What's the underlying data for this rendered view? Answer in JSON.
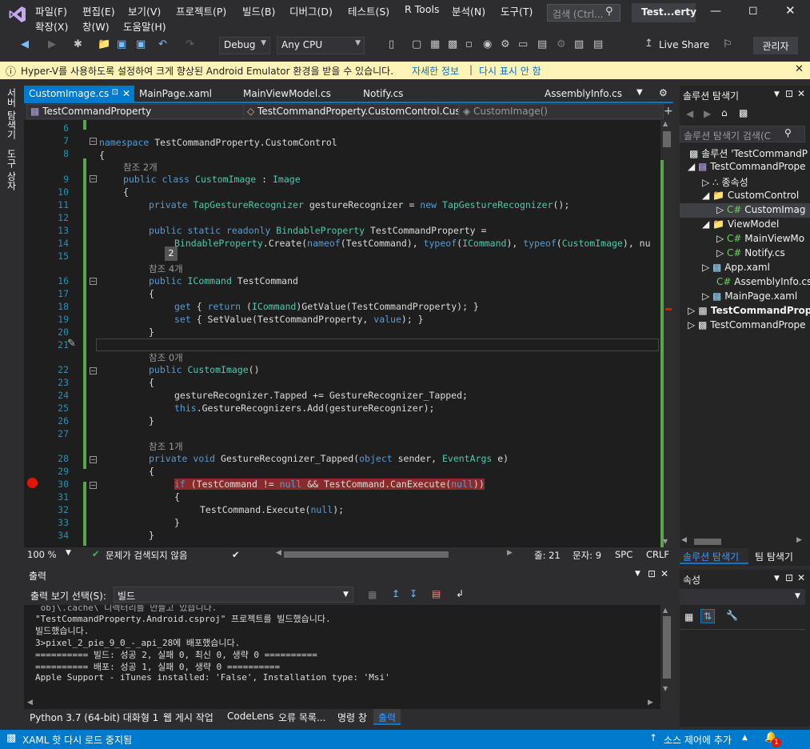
{
  "menu": {
    "row1": [
      "파일(F)",
      "편집(E)",
      "보기(V)",
      "프로젝트(P)",
      "빌드(B)",
      "디버그(D)",
      "테스트(S)",
      "R Tools",
      "분석(N)",
      "도구(T)"
    ],
    "row2": [
      "확장(X)",
      "창(W)",
      "도움말(H)"
    ],
    "search_placeholder": "검색 (Ctrl...",
    "window_title": "Test...erty"
  },
  "toolbar": {
    "config": "Debug",
    "platform": "Any CPU",
    "live_share": "Live Share",
    "admin": "관리자"
  },
  "infobar": {
    "message": "Hyper-V를 사용하도록 설정하여 크게 향상된 Android Emulator 환경을 받을 수 있습니다.",
    "link1": "자세한 정보",
    "sep": "|",
    "link2": "다시 표시 안 함"
  },
  "left_tabs": [
    "서버 탐색기",
    "도구 상자"
  ],
  "doc_tabs": [
    "CustomImage.cs",
    "MainPage.xaml",
    "MainViewModel.cs",
    "Notify.cs",
    "AssemblyInfo.cs"
  ],
  "nav": {
    "project": "TestCommandProperty",
    "type": "TestCommandProperty.CustomControl.Cust",
    "member": "CustomImage()"
  },
  "editor": {
    "lines": [
      "6",
      "7",
      "8",
      "9",
      "10",
      "11",
      "12",
      "13",
      "14",
      "15",
      "16",
      "17",
      "18",
      "19",
      "20",
      "21",
      "22",
      "23",
      "24",
      "25",
      "26",
      "27",
      "28",
      "29",
      "30",
      "31",
      "32",
      "33",
      "34"
    ],
    "refs": [
      "참조 2개",
      "참조 4개",
      "참조 0개",
      "참조 1개"
    ],
    "tooltip": "2"
  },
  "editor_status": {
    "zoom": "100 %",
    "issues": "문제가 검색되지 않음",
    "line": "줄: 21",
    "col": "문자: 9",
    "spc": "SPC",
    "crlf": "CRLF"
  },
  "solution": {
    "title": "솔루션 탐색기",
    "search": "솔루션 탐색기 검색(C",
    "items": [
      "솔루션 'TestCommandP",
      "TestCommandPrope",
      "종속성",
      "CustomControl",
      "CustomImag",
      "ViewModel",
      "MainViewMo",
      "Notify.cs",
      "App.xaml",
      "AssemblyInfo.cs",
      "MainPage.xaml",
      "TestCommandProp",
      "TestCommandPrope"
    ],
    "tab1": "솔루션 탐색기",
    "tab2": "팀 탐색기"
  },
  "output": {
    "title": "출력",
    "show_label": "출력 보기 선택(S):",
    "source": "빌드",
    "lines": [
      " obj\\.cache\\ 디렉터리를 만들고 있습니다.",
      "\"TestCommandProperty.Android.csproj\" 프로젝트를 빌드했습니다.",
      "빌드했습니다.",
      "3>pixel_2_pie_9_0_-_api_28에 배포했습니다.",
      "========== 빌드: 성공 2, 실패 0, 최신 0, 생략 0 ==========",
      "========== 배포: 성공 1, 실패 0, 생략 0 ==========",
      "Apple Support - iTunes installed: 'False', Installation type: 'Msi'"
    ]
  },
  "bottom_tabs": [
    "Python 3.7 (64-bit) 대화형 1",
    "웹 게시 작업",
    "CodeLens",
    "오류 목록...",
    "명령 창",
    "출력"
  ],
  "props": {
    "title": "속성"
  },
  "statusbar": {
    "left": "XAML 핫 다시 로드 중지됨",
    "source_control": "소스 제어에 추가",
    "notif": "1"
  }
}
